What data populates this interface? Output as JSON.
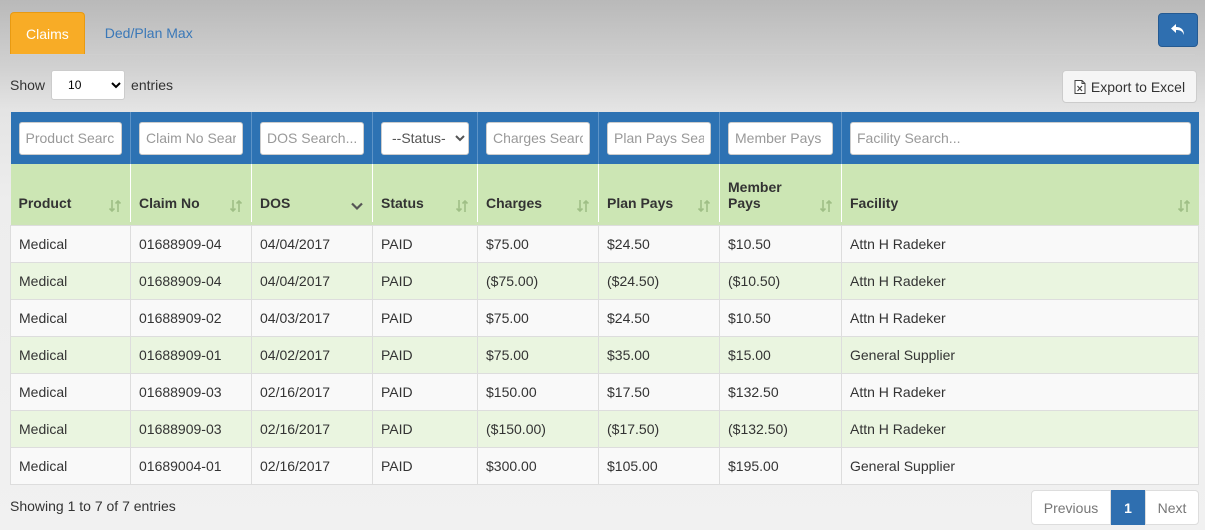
{
  "tabs": [
    {
      "label": "Claims",
      "active": true
    },
    {
      "label": "Ded/Plan Max",
      "active": false
    }
  ],
  "icons": {
    "back": "undo-arrow-icon",
    "export": "excel-file-icon",
    "sort": "sort-arrows-icon",
    "sort_desc": "chevron-down-icon"
  },
  "length": {
    "show_label": "Show",
    "selected": "10",
    "entries_label": "entries"
  },
  "export_label": "Export to Excel",
  "filters": {
    "product": "Product Search...",
    "claim_no": "Claim No Search...",
    "dos": "DOS Search...",
    "status": "--Status--",
    "charges": "Charges Search...",
    "plan_pays": "Plan Pays Search...",
    "member_pays": "Member Pays",
    "facility": "Facility Search..."
  },
  "columns": {
    "product": "Product",
    "claim_no": "Claim No",
    "dos": "DOS",
    "status": "Status",
    "charges": "Charges",
    "plan_pays": "Plan Pays",
    "member_pays_1": "Member",
    "member_pays_2": "Pays",
    "facility": "Facility"
  },
  "rows": [
    {
      "product": "Medical",
      "claim_no": "01688909-04",
      "dos": "04/04/2017",
      "status": "PAID",
      "charges": "$75.00",
      "plan_pays": "$24.50",
      "member_pays": "$10.50",
      "facility": "Attn H Radeker"
    },
    {
      "product": "Medical",
      "claim_no": "01688909-04",
      "dos": "04/04/2017",
      "status": "PAID",
      "charges": "($75.00)",
      "plan_pays": "($24.50)",
      "member_pays": "($10.50)",
      "facility": "Attn H Radeker"
    },
    {
      "product": "Medical",
      "claim_no": "01688909-02",
      "dos": "04/03/2017",
      "status": "PAID",
      "charges": "$75.00",
      "plan_pays": "$24.50",
      "member_pays": "$10.50",
      "facility": "Attn H Radeker"
    },
    {
      "product": "Medical",
      "claim_no": "01688909-01",
      "dos": "04/02/2017",
      "status": "PAID",
      "charges": "$75.00",
      "plan_pays": "$35.00",
      "member_pays": "$15.00",
      "facility": "General Supplier"
    },
    {
      "product": "Medical",
      "claim_no": "01688909-03",
      "dos": "02/16/2017",
      "status": "PAID",
      "charges": "$150.00",
      "plan_pays": "$17.50",
      "member_pays": "$132.50",
      "facility": "Attn H Radeker"
    },
    {
      "product": "Medical",
      "claim_no": "01688909-03",
      "dos": "02/16/2017",
      "status": "PAID",
      "charges": "($150.00)",
      "plan_pays": "($17.50)",
      "member_pays": "($132.50)",
      "facility": "Attn H Radeker"
    },
    {
      "product": "Medical",
      "claim_no": "01689004-01",
      "dos": "02/16/2017",
      "status": "PAID",
      "charges": "$300.00",
      "plan_pays": "$105.00",
      "member_pays": "$195.00",
      "facility": "General Supplier"
    }
  ],
  "info": "Showing 1 to 7 of 7 entries",
  "pager": {
    "previous": "Previous",
    "current": "1",
    "next": "Next"
  },
  "colors": {
    "accent_tab": "#f8ac26",
    "primary": "#2f6fb0",
    "header_green": "#cce6b4",
    "row_green": "#eaf5e0"
  }
}
